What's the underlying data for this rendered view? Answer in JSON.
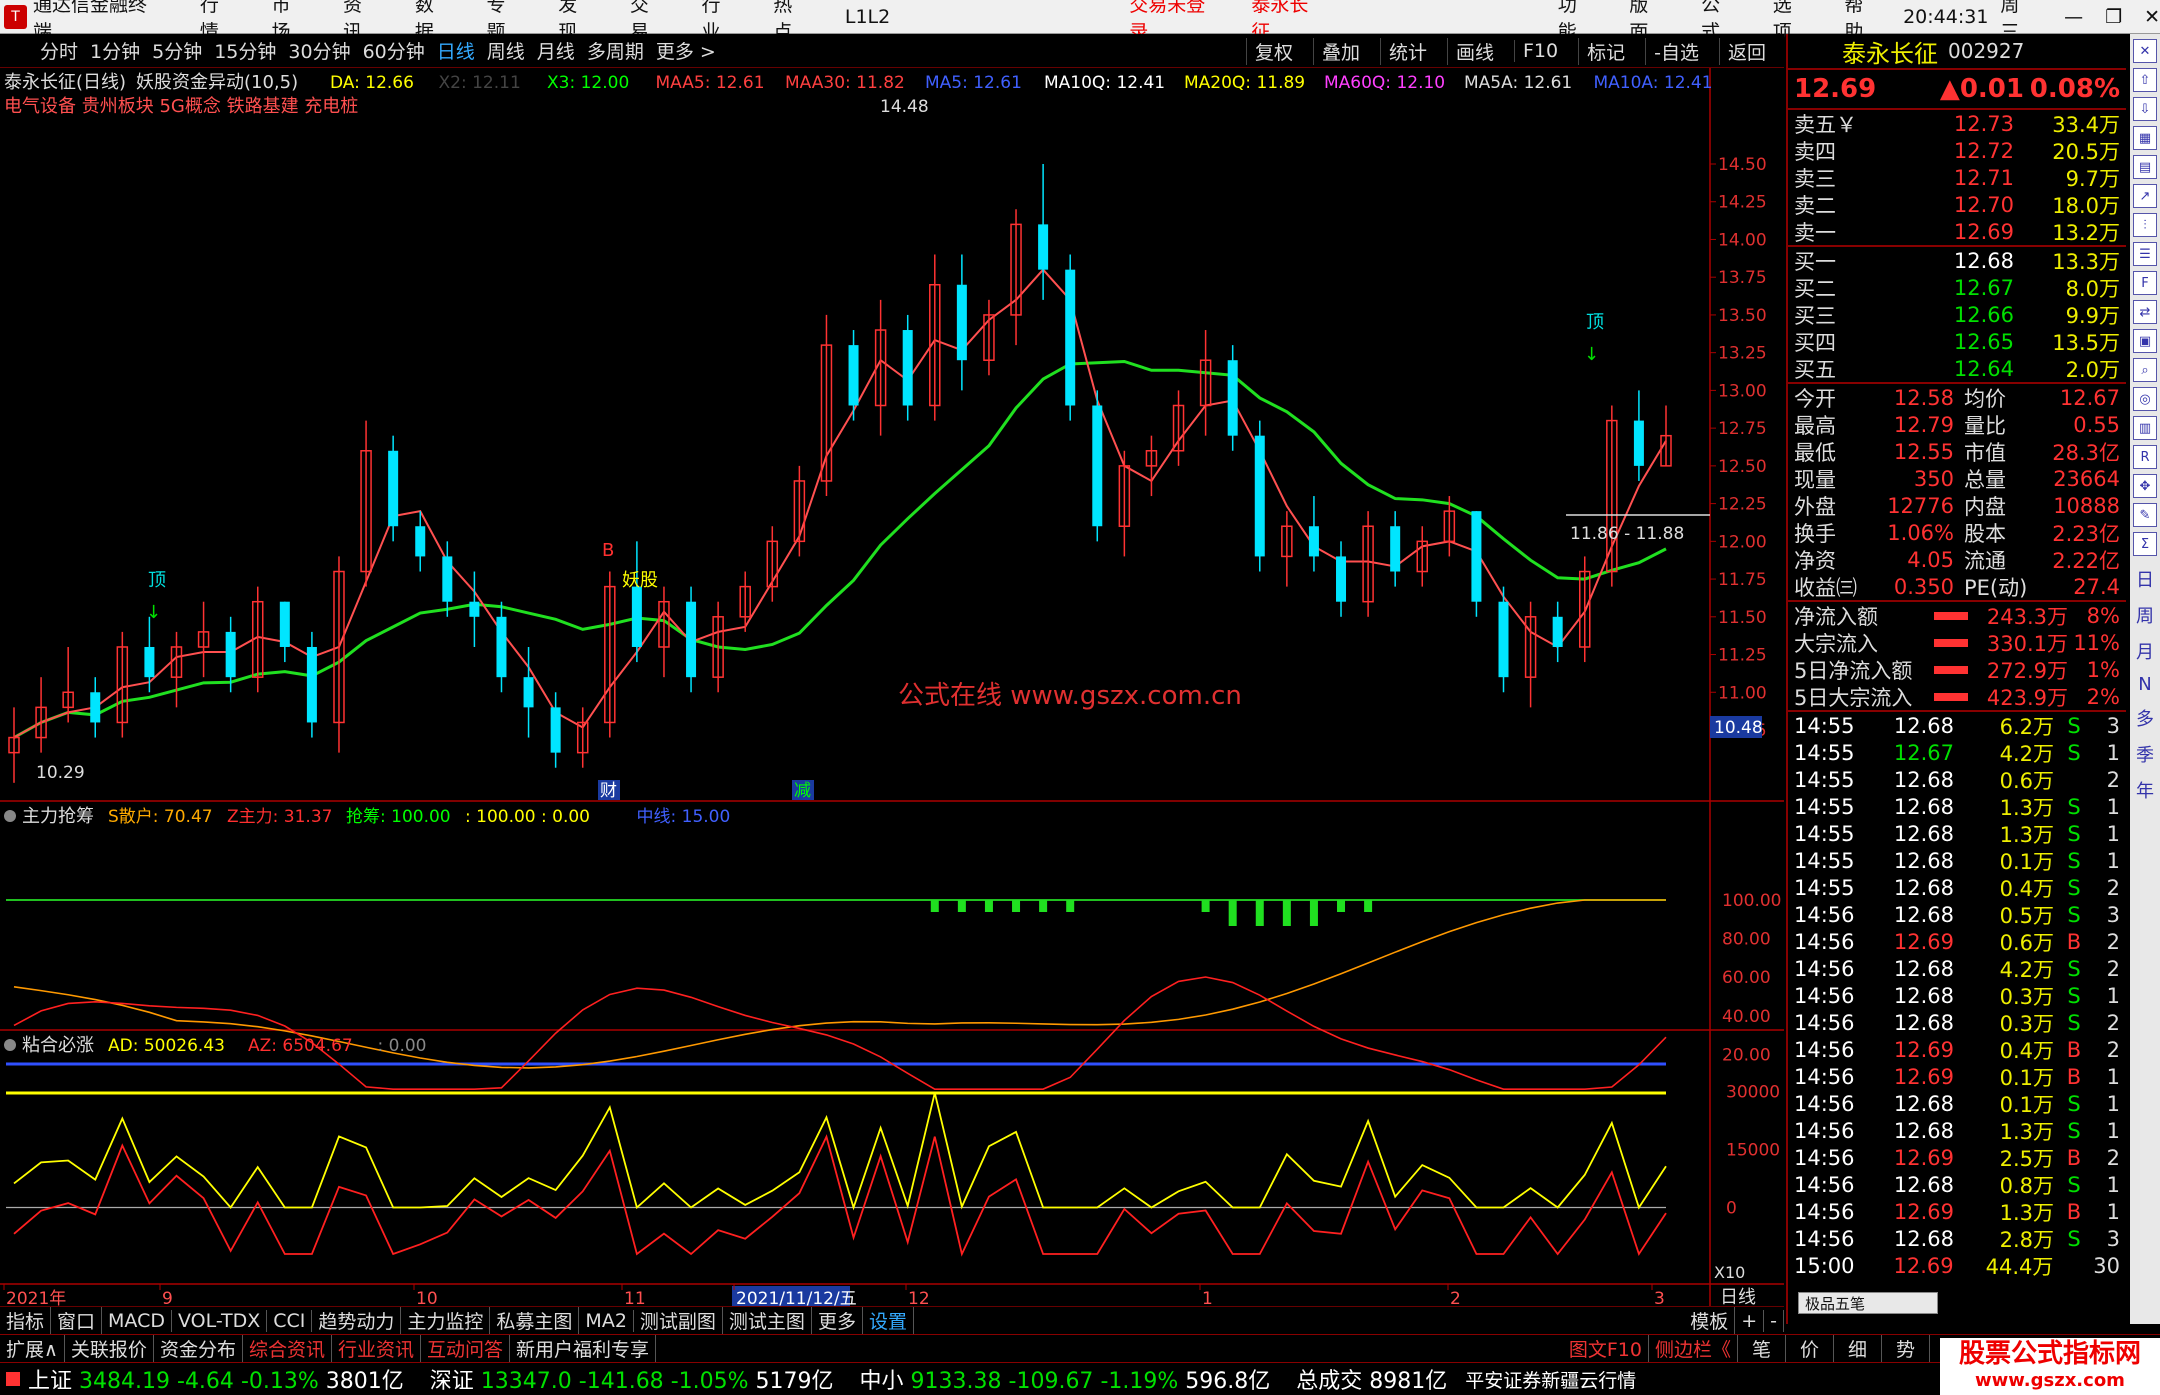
{
  "menubar": {
    "app_title": "通达信金融终端",
    "items": [
      "行情",
      "市场",
      "资讯",
      "数据",
      "专题",
      "发现",
      "交易",
      "行业",
      "热点",
      "L1L2"
    ],
    "login": "交易未登录",
    "stock": "泰永长征",
    "right": [
      "功能",
      "版面",
      "公式",
      "选项",
      "帮助"
    ],
    "time": "20:44:31",
    "weekday": "周三"
  },
  "toolbar": {
    "left": [
      "分时",
      "1分钟",
      "5分钟",
      "15分钟",
      "30分钟",
      "60分钟",
      "日线",
      "周线",
      "月线",
      "多周期",
      "更多 >"
    ],
    "active": "日线",
    "right": [
      "复权",
      "叠加",
      "统计",
      "画线",
      "F10",
      "标记",
      "-自选",
      "返回"
    ]
  },
  "main": {
    "title": "泰永长征(日线)",
    "indicator": "妖股资金异动(10,5)",
    "legend": [
      {
        "t": "DA: 12.66",
        "c": "#ffff00"
      },
      {
        "t": "X2: 12.11",
        "c": "#444"
      },
      {
        "t": "X3: 12.00",
        "c": "#00ff00"
      },
      {
        "t": "MAA5: 12.61",
        "c": "#ff4040"
      },
      {
        "t": "MAA30: 11.82",
        "c": "#ff4040"
      },
      {
        "t": "MA5: 12.61",
        "c": "#4060ff"
      },
      {
        "t": "MA10Q: 12.41",
        "c": "#ffffff"
      },
      {
        "t": "MA20Q: 11.89",
        "c": "#ffff00"
      },
      {
        "t": "MA60Q: 12.10",
        "c": "#ff40ff"
      },
      {
        "t": "MA5A: 12.61",
        "c": "#dddddd"
      },
      {
        "t": "MA10A: 12.41",
        "c": "#4060ff"
      }
    ],
    "concepts": "电气设备 贵州板块 5G概念 铁路基建 充电桩",
    "watermark": "公式在线 www.gszx.com.cn",
    "yaxis": [
      "14.50",
      "14.25",
      "14.00",
      "13.75",
      "13.50",
      "13.25",
      "13.00",
      "12.75",
      "12.50",
      "12.25",
      "12.00",
      "11.75",
      "11.50",
      "11.25",
      "11.00",
      "10.75"
    ],
    "cur_price": "10.48",
    "max_label": "14.48",
    "min_label": "10.29",
    "range_label": "11.86 - 11.88",
    "tags": {
      "ding1": "顶",
      "ding2": "顶",
      "b": "B",
      "yaogu": "妖股",
      "cai": "财",
      "jian": "减"
    }
  },
  "ind1": {
    "title": "主力抢筹",
    "legend": [
      {
        "t": "S散户: 70.47",
        "c": "#ffaa00"
      },
      {
        "t": "Z主力: 31.37",
        "c": "#ff3030"
      },
      {
        "t": "抢筹: 100.00",
        "c": "#00ff00"
      },
      {
        "t": ": 100.00 : 0.00",
        "c": "#ffff00"
      },
      {
        "t": "中线: 15.00",
        "c": "#4060ff"
      }
    ],
    "yaxis": [
      "100.00",
      "80.00",
      "60.00",
      "40.00",
      "20.00"
    ]
  },
  "ind2": {
    "title": "粘合必涨",
    "legend": [
      {
        "t": "AD: 50026.43",
        "c": "#ffff00"
      },
      {
        "t": "AZ: 6504.67",
        "c": "#ff3030"
      },
      {
        "t": ": 0.00",
        "c": "#888"
      }
    ],
    "yaxis": [
      "30000",
      "15000",
      "0"
    ],
    "scale": "X10"
  },
  "xaxis": {
    "labels": [
      "2021年",
      "9",
      "10",
      "11",
      "2021/11/12/五",
      "12",
      "1",
      "2",
      "3"
    ],
    "mode": "日线"
  },
  "quote": {
    "name": "泰永长征",
    "code": "002927",
    "price": "12.69",
    "change": "▲0.01",
    "pct": "0.08%",
    "asks": [
      {
        "l": "卖五￥",
        "p": "12.73",
        "v": "33.4万"
      },
      {
        "l": "卖四",
        "p": "12.72",
        "v": "20.5万"
      },
      {
        "l": "卖三",
        "p": "12.71",
        "v": "9.7万"
      },
      {
        "l": "卖二",
        "p": "12.70",
        "v": "18.0万"
      },
      {
        "l": "卖一",
        "p": "12.69",
        "v": "13.2万"
      }
    ],
    "bids": [
      {
        "l": "买一",
        "p": "12.68",
        "v": "13.3万"
      },
      {
        "l": "买二",
        "p": "12.67",
        "v": "8.0万"
      },
      {
        "l": "买三",
        "p": "12.66",
        "v": "9.9万"
      },
      {
        "l": "买四",
        "p": "12.65",
        "v": "13.5万"
      },
      {
        "l": "买五",
        "p": "12.64",
        "v": "2.0万"
      }
    ],
    "stats": [
      [
        "今开",
        "12.58",
        "均价",
        "12.67"
      ],
      [
        "最高",
        "12.79",
        "量比",
        "0.55"
      ],
      [
        "最低",
        "12.55",
        "市值",
        "28.3亿"
      ],
      [
        "现量",
        "350",
        "总量",
        "23664"
      ],
      [
        "外盘",
        "12776",
        "内盘",
        "10888"
      ],
      [
        "换手",
        "1.06%",
        "股本",
        "2.23亿"
      ],
      [
        "净资",
        "4.05",
        "流通",
        "2.22亿"
      ],
      [
        "收益㈢",
        "0.350",
        "PE(动)",
        "27.4"
      ]
    ],
    "flows": [
      [
        "净流入额",
        "243.3万",
        "8%"
      ],
      [
        "大宗流入",
        "330.1万",
        "11%"
      ],
      [
        "5日净流入额",
        "272.9万",
        "1%"
      ],
      [
        "5日大宗流入",
        "423.9万",
        "2%"
      ]
    ],
    "ticks": [
      [
        "14:55",
        "12.68",
        "6.2万",
        "S",
        "3"
      ],
      [
        "14:55",
        "12.67",
        "4.2万",
        "S",
        "1"
      ],
      [
        "14:55",
        "12.68",
        "0.6万",
        "",
        "2"
      ],
      [
        "14:55",
        "12.68",
        "1.3万",
        "S",
        "1"
      ],
      [
        "14:55",
        "12.68",
        "1.3万",
        "S",
        "1"
      ],
      [
        "14:55",
        "12.68",
        "0.1万",
        "S",
        "1"
      ],
      [
        "14:55",
        "12.68",
        "0.4万",
        "S",
        "2"
      ],
      [
        "14:56",
        "12.68",
        "0.5万",
        "S",
        "3"
      ],
      [
        "14:56",
        "12.69",
        "0.6万",
        "B",
        "2"
      ],
      [
        "14:56",
        "12.68",
        "4.2万",
        "S",
        "2"
      ],
      [
        "14:56",
        "12.68",
        "0.3万",
        "S",
        "1"
      ],
      [
        "14:56",
        "12.68",
        "0.3万",
        "S",
        "2"
      ],
      [
        "14:56",
        "12.69",
        "0.4万",
        "B",
        "2"
      ],
      [
        "14:56",
        "12.69",
        "0.1万",
        "B",
        "1"
      ],
      [
        "14:56",
        "12.68",
        "0.1万",
        "S",
        "1"
      ],
      [
        "14:56",
        "12.68",
        "1.3万",
        "S",
        "1"
      ],
      [
        "14:56",
        "12.69",
        "2.5万",
        "B",
        "2"
      ],
      [
        "14:56",
        "12.68",
        "0.8万",
        "S",
        "1"
      ],
      [
        "14:56",
        "12.69",
        "1.3万",
        "B",
        "1"
      ],
      [
        "14:56",
        "12.68",
        "2.8万",
        "S",
        "3"
      ],
      [
        "15:00",
        "12.69",
        "44.4万",
        "",
        "30"
      ]
    ],
    "popup": "极品五笔"
  },
  "sidetool": {
    "items": [
      "日",
      "周",
      "月",
      "N",
      "多",
      "季",
      "年"
    ]
  },
  "bottom1": {
    "tabs": [
      "指标",
      "窗口",
      "MACD",
      "VOL-TDX",
      "CCI",
      "趋势动力",
      "主力监控",
      "私募主图",
      "MA2",
      "测试副图",
      "测试主图",
      "更多",
      "设置"
    ],
    "active": "设置",
    "right": [
      "模板",
      "+",
      "-"
    ]
  },
  "bottom2": {
    "tabs": [
      "扩展∧",
      "关联报价",
      "资金分布",
      "综合资讯",
      "行业资讯",
      "互动问答",
      "新用户福利专享"
    ],
    "red": [
      "综合资讯",
      "行业资讯",
      "互动问答"
    ],
    "right": [
      "图文F10",
      "侧边栏《",
      "笔",
      "价",
      "细",
      "势"
    ]
  },
  "ticker": [
    {
      "n": "上证",
      "v": "3484.19",
      "c": "-4.64",
      "p": "-0.13%",
      "a": "3801亿"
    },
    {
      "n": "深证",
      "v": "13347.0",
      "c": "-141.68",
      "p": "-1.05%",
      "a": "5179亿"
    },
    {
      "n": "中小",
      "v": "9133.38",
      "c": "-109.67",
      "p": "-1.19%",
      "a": "596.8亿"
    }
  ],
  "ticker_extra": {
    "label": "总成交",
    "value": "8981亿",
    "broker": "平安证券新疆云行情"
  },
  "brand": "股票公式指标网",
  "brand_url": "www.gszx.com",
  "chart_data": {
    "type": "candlestick",
    "title": "泰永长征(日线)",
    "x": [
      "2021年",
      "9",
      "10",
      "11",
      "2021/11/12/五",
      "12",
      "1",
      "2",
      "3"
    ],
    "ylim": [
      10.5,
      14.6
    ],
    "max": 14.48,
    "min": 10.29,
    "last_close": 12.69,
    "candles": [
      [
        10.6,
        10.9,
        10.4,
        10.7
      ],
      [
        10.7,
        11.1,
        10.6,
        10.9
      ],
      [
        10.9,
        11.3,
        10.8,
        11.0
      ],
      [
        11.0,
        11.1,
        10.7,
        10.8
      ],
      [
        10.8,
        11.4,
        10.7,
        11.3
      ],
      [
        11.3,
        11.5,
        11.0,
        11.1
      ],
      [
        11.1,
        11.4,
        10.9,
        11.3
      ],
      [
        11.3,
        11.6,
        11.1,
        11.4
      ],
      [
        11.4,
        11.5,
        11.0,
        11.1
      ],
      [
        11.1,
        11.7,
        11.0,
        11.6
      ],
      [
        11.6,
        11.6,
        11.2,
        11.3
      ],
      [
        11.3,
        11.4,
        10.7,
        10.8
      ],
      [
        10.8,
        11.9,
        10.6,
        11.8
      ],
      [
        11.8,
        12.8,
        11.7,
        12.6
      ],
      [
        12.6,
        12.7,
        12.0,
        12.1
      ],
      [
        12.1,
        12.2,
        11.8,
        11.9
      ],
      [
        11.9,
        12.0,
        11.5,
        11.6
      ],
      [
        11.6,
        11.8,
        11.3,
        11.5
      ],
      [
        11.5,
        11.6,
        11.0,
        11.1
      ],
      [
        11.1,
        11.3,
        10.7,
        10.9
      ],
      [
        10.9,
        11.0,
        10.5,
        10.6
      ],
      [
        10.6,
        10.9,
        10.5,
        10.8
      ],
      [
        10.8,
        11.8,
        10.7,
        11.7
      ],
      [
        11.7,
        12.0,
        11.2,
        11.3
      ],
      [
        11.3,
        11.7,
        11.1,
        11.6
      ],
      [
        11.6,
        11.7,
        11.0,
        11.1
      ],
      [
        11.1,
        11.6,
        11.0,
        11.5
      ],
      [
        11.5,
        11.8,
        11.4,
        11.7
      ],
      [
        11.7,
        12.1,
        11.6,
        12.0
      ],
      [
        12.0,
        12.5,
        11.9,
        12.4
      ],
      [
        12.4,
        13.5,
        12.3,
        13.3
      ],
      [
        13.3,
        13.4,
        12.8,
        12.9
      ],
      [
        12.9,
        13.6,
        12.7,
        13.4
      ],
      [
        13.4,
        13.5,
        12.8,
        12.9
      ],
      [
        12.9,
        13.9,
        12.8,
        13.7
      ],
      [
        13.7,
        13.9,
        13.0,
        13.2
      ],
      [
        13.2,
        13.6,
        13.1,
        13.5
      ],
      [
        13.5,
        14.2,
        13.3,
        14.1
      ],
      [
        14.1,
        14.5,
        13.6,
        13.8
      ],
      [
        13.8,
        13.9,
        12.8,
        12.9
      ],
      [
        12.9,
        13.0,
        12.0,
        12.1
      ],
      [
        12.1,
        12.6,
        11.9,
        12.5
      ],
      [
        12.5,
        12.7,
        12.3,
        12.6
      ],
      [
        12.6,
        13.0,
        12.5,
        12.9
      ],
      [
        12.9,
        13.4,
        12.7,
        13.2
      ],
      [
        13.2,
        13.3,
        12.6,
        12.7
      ],
      [
        12.7,
        12.8,
        11.8,
        11.9
      ],
      [
        11.9,
        12.2,
        11.7,
        12.1
      ],
      [
        12.1,
        12.3,
        11.8,
        11.9
      ],
      [
        11.9,
        12.0,
        11.5,
        11.6
      ],
      [
        11.6,
        12.2,
        11.5,
        12.1
      ],
      [
        12.1,
        12.2,
        11.7,
        11.8
      ],
      [
        11.8,
        12.1,
        11.7,
        12.0
      ],
      [
        12.0,
        12.3,
        11.9,
        12.2
      ],
      [
        12.2,
        12.2,
        11.5,
        11.6
      ],
      [
        11.6,
        11.7,
        11.0,
        11.1
      ],
      [
        11.1,
        11.6,
        10.9,
        11.5
      ],
      [
        11.5,
        11.6,
        11.2,
        11.3
      ],
      [
        11.3,
        11.9,
        11.2,
        11.8
      ],
      [
        11.8,
        12.9,
        11.7,
        12.8
      ],
      [
        12.8,
        13.0,
        12.4,
        12.5
      ],
      [
        12.5,
        12.9,
        12.5,
        12.7
      ]
    ]
  }
}
